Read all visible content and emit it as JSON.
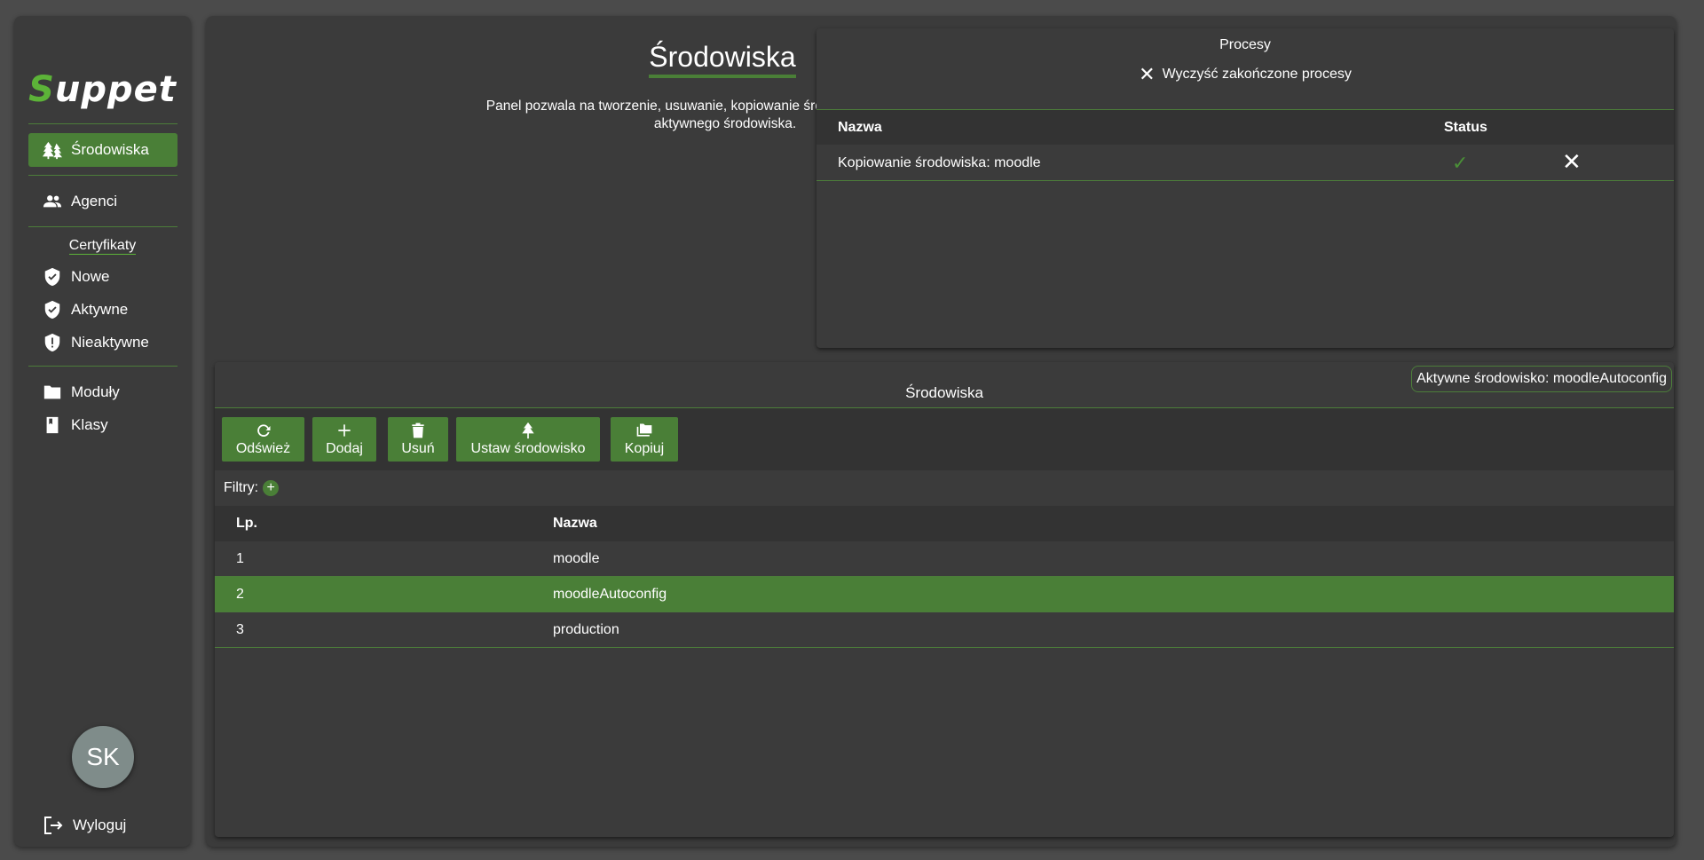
{
  "app": {
    "logo_first": "S",
    "logo_rest": "uppet"
  },
  "sidebar": {
    "items": [
      {
        "label": "Środowiska",
        "icon": "trees-icon",
        "active": true
      },
      {
        "label": "Agenci",
        "icon": "people-icon",
        "active": false
      }
    ],
    "certs_title": "Certyfikaty",
    "cert_items": [
      {
        "label": "Nowe",
        "icon": "shield-check-icon"
      },
      {
        "label": "Aktywne",
        "icon": "shield-check-icon"
      },
      {
        "label": "Nieaktywne",
        "icon": "shield-alert-icon"
      }
    ],
    "other_items": [
      {
        "label": "Moduły",
        "icon": "folder-icon"
      },
      {
        "label": "Klasy",
        "icon": "book-icon"
      }
    ],
    "avatar_initials": "SK",
    "logout_label": "Wyloguj"
  },
  "header": {
    "title": "Środowiska",
    "description": "Panel pozwala na tworzenie, usuwanie, kopiowanie środowisk oraz ustawianie aktywnego środowiska."
  },
  "processes": {
    "title": "Procesy",
    "clear_label": "Wyczyść zakończone procesy",
    "columns": {
      "name": "Nazwa",
      "status": "Status"
    },
    "rows": [
      {
        "name": "Kopiowanie środowiska: moodle",
        "status": "done"
      }
    ]
  },
  "environments": {
    "title": "Środowiska",
    "active_label": "Aktywne środowisko: moodleAutoconfig",
    "toolbar": {
      "refresh": "Odśwież",
      "add": "Dodaj",
      "delete": "Usuń",
      "set_env": "Ustaw środowisko",
      "copy": "Kopiuj"
    },
    "filters_label": "Filtry:",
    "columns": {
      "lp": "Lp.",
      "name": "Nazwa"
    },
    "rows": [
      {
        "lp": "1",
        "name": "moodle",
        "selected": false
      },
      {
        "lp": "2",
        "name": "moodleAutoconfig",
        "selected": true
      },
      {
        "lp": "3",
        "name": "production",
        "selected": false
      }
    ]
  },
  "colors": {
    "accent": "#4a7f37",
    "logo_accent": "#5cb338",
    "background": "#3b3b3b"
  }
}
